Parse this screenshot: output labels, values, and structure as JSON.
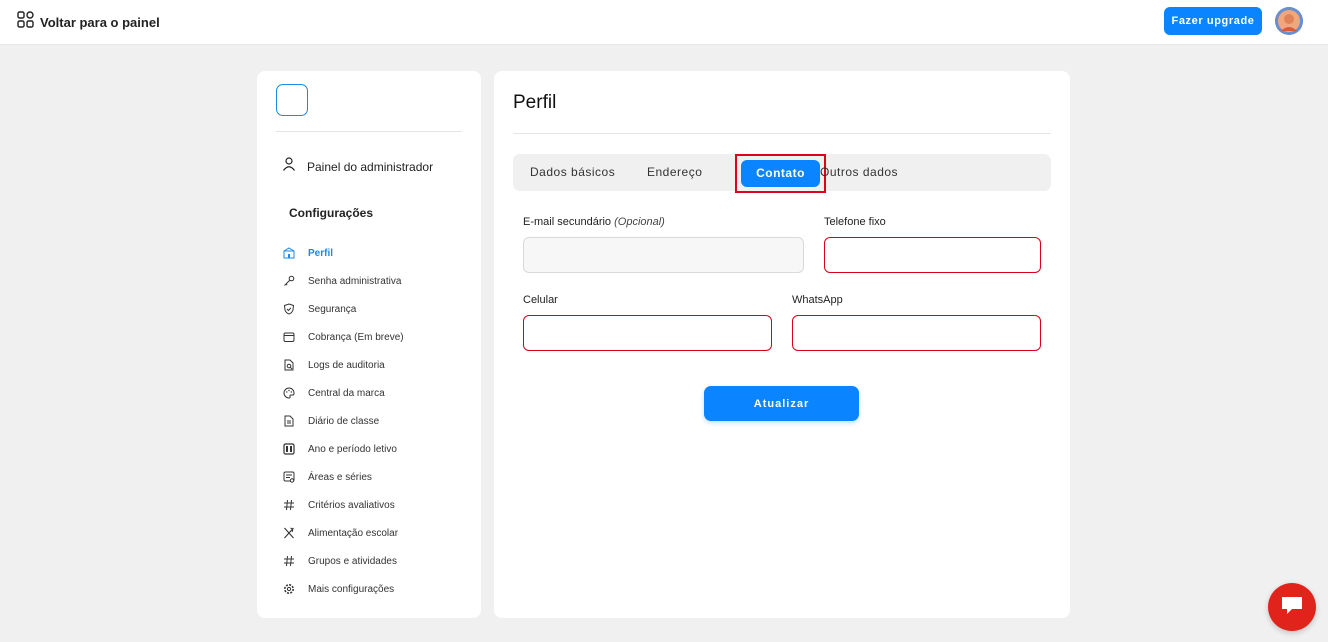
{
  "topbar": {
    "back_label": "Voltar para o painel",
    "upgrade_label": "Fazer upgrade",
    "back_icon": "grid-icon",
    "avatar": "avatar"
  },
  "sidebar": {
    "admin_label": "Painel do administrador",
    "section_title": "Configurações",
    "items": [
      {
        "label": "Perfil",
        "icon": "school-icon",
        "active": true
      },
      {
        "label": "Senha administrativa",
        "icon": "key-icon"
      },
      {
        "label": "Segurança",
        "icon": "shield-icon"
      },
      {
        "label": "Cobrança (Em breve)",
        "icon": "wallet-icon"
      },
      {
        "label": "Logs de auditoria",
        "icon": "file-search-icon"
      },
      {
        "label": "Central da marca",
        "icon": "palette-icon"
      },
      {
        "label": "Diário de classe",
        "icon": "document-icon"
      },
      {
        "label": "Ano e período letivo",
        "icon": "calendar-icon"
      },
      {
        "label": "Áreas e séries",
        "icon": "list-icon"
      },
      {
        "label": "Critérios avaliativos",
        "icon": "hash-icon"
      },
      {
        "label": "Alimentação escolar",
        "icon": "utensils-icon"
      },
      {
        "label": "Grupos e atividades",
        "icon": "hash-icon"
      },
      {
        "label": "Mais configurações",
        "icon": "gear-icon"
      }
    ]
  },
  "main": {
    "title": "Perfil",
    "tabs": [
      {
        "label": "Dados básicos"
      },
      {
        "label": "Endereço"
      },
      {
        "label": "Contato",
        "active": true
      },
      {
        "label": "Outros dados"
      }
    ],
    "form": {
      "secondary_email_label": "E-mail secundário",
      "secondary_email_optional": "(Opcional)",
      "secondary_email_value": "",
      "landline_label": "Telefone fixo",
      "landline_value": "",
      "mobile_label": "Celular",
      "mobile_value": "",
      "whatsapp_label": "WhatsApp",
      "whatsapp_value": "",
      "submit_label": "Atualizar"
    }
  },
  "colors": {
    "accent": "#0a84ff",
    "error": "#d9001b",
    "chat": "#e0241b"
  }
}
